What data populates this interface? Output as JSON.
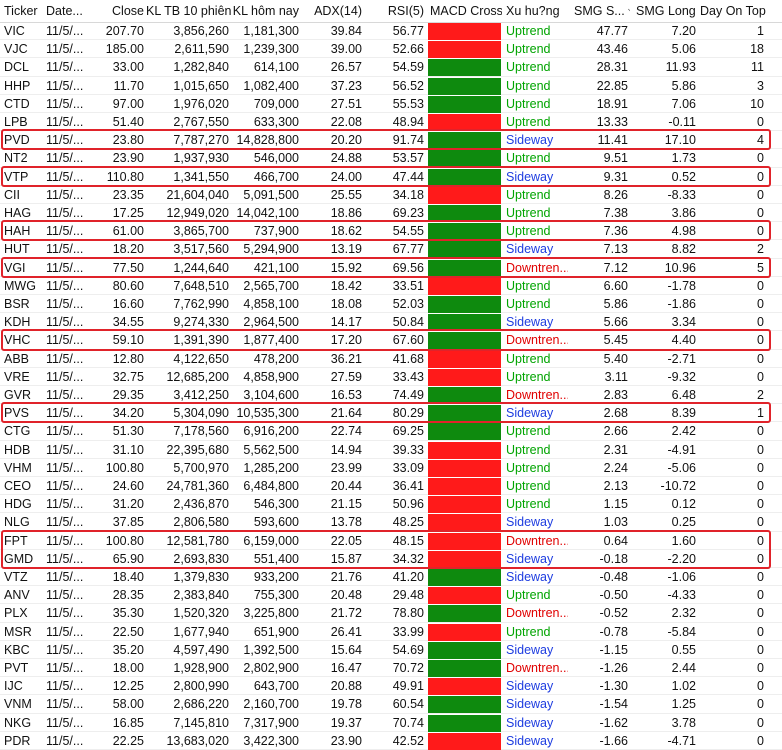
{
  "columns": {
    "ticker": "Ticker",
    "date": "Date...",
    "close": "Close",
    "kl10": "KL TB 10 phiên",
    "klday": "KL hôm nay",
    "adx": "ADX(14)",
    "rsi": "RSI(5)",
    "macd": "MACD Cross",
    "trend": "Xu hu?ng",
    "smg_short": "SMG S...",
    "smg_long": "SMG Long",
    "dayontop": "Day On Top"
  },
  "colors": {
    "macd_red": "#ff1a1a",
    "macd_green": "#0e8a0e",
    "uptrend": "#00a400",
    "sideway": "#1d3ce0",
    "downtrend": "#e00000",
    "highlight": "#e0232a"
  },
  "rows": [
    {
      "t": "VIC",
      "d": "11/5/...",
      "c": "207.70",
      "k10": "3,856,260",
      "kd": "1,181,300",
      "a": "39.84",
      "r": "56.77",
      "m": "red",
      "x": "Uptrend",
      "xt": "up",
      "s": "47.77",
      "l": "7.20",
      "o": "1"
    },
    {
      "t": "VJC",
      "d": "11/5/...",
      "c": "185.00",
      "k10": "2,611,590",
      "kd": "1,239,300",
      "a": "39.00",
      "r": "52.66",
      "m": "red",
      "x": "Uptrend",
      "xt": "up",
      "s": "43.46",
      "l": "5.06",
      "o": "18"
    },
    {
      "t": "DCL",
      "d": "11/5/...",
      "c": "33.00",
      "k10": "1,282,840",
      "kd": "614,100",
      "a": "26.57",
      "r": "54.59",
      "m": "green",
      "x": "Uptrend",
      "xt": "up",
      "s": "28.31",
      "l": "11.93",
      "o": "11"
    },
    {
      "t": "HHP",
      "d": "11/5/...",
      "c": "11.70",
      "k10": "1,015,650",
      "kd": "1,082,400",
      "a": "37.23",
      "r": "56.52",
      "m": "green",
      "x": "Uptrend",
      "xt": "up",
      "s": "22.85",
      "l": "5.86",
      "o": "3"
    },
    {
      "t": "CTD",
      "d": "11/5/...",
      "c": "97.00",
      "k10": "1,976,020",
      "kd": "709,000",
      "a": "27.51",
      "r": "55.53",
      "m": "green",
      "x": "Uptrend",
      "xt": "up",
      "s": "18.91",
      "l": "7.06",
      "o": "10"
    },
    {
      "t": "LPB",
      "d": "11/5/...",
      "c": "51.40",
      "k10": "2,767,550",
      "kd": "633,300",
      "a": "22.08",
      "r": "48.94",
      "m": "red",
      "x": "Uptrend",
      "xt": "up",
      "s": "13.33",
      "l": "-0.11",
      "o": "0"
    },
    {
      "t": "PVD",
      "d": "11/5/...",
      "c": "23.80",
      "k10": "7,787,270",
      "kd": "14,828,800",
      "a": "20.20",
      "r": "91.74",
      "m": "green",
      "x": "Sideway",
      "xt": "side",
      "s": "11.41",
      "l": "17.10",
      "o": "4"
    },
    {
      "t": "NT2",
      "d": "11/5/...",
      "c": "23.90",
      "k10": "1,937,930",
      "kd": "546,000",
      "a": "24.88",
      "r": "53.57",
      "m": "green",
      "x": "Uptrend",
      "xt": "up",
      "s": "9.51",
      "l": "1.73",
      "o": "0"
    },
    {
      "t": "VTP",
      "d": "11/5/...",
      "c": "110.80",
      "k10": "1,341,550",
      "kd": "466,700",
      "a": "24.00",
      "r": "47.44",
      "m": "green",
      "x": "Sideway",
      "xt": "side",
      "s": "9.31",
      "l": "0.52",
      "o": "0"
    },
    {
      "t": "CII",
      "d": "11/5/...",
      "c": "23.35",
      "k10": "21,604,040",
      "kd": "5,091,500",
      "a": "25.55",
      "r": "34.18",
      "m": "red",
      "x": "Uptrend",
      "xt": "up",
      "s": "8.26",
      "l": "-8.33",
      "o": "0"
    },
    {
      "t": "HAG",
      "d": "11/5/...",
      "c": "17.25",
      "k10": "12,949,020",
      "kd": "14,042,100",
      "a": "18.86",
      "r": "69.23",
      "m": "green",
      "x": "Uptrend",
      "xt": "up",
      "s": "7.38",
      "l": "3.86",
      "o": "0"
    },
    {
      "t": "HAH",
      "d": "11/5/...",
      "c": "61.00",
      "k10": "3,865,700",
      "kd": "737,900",
      "a": "18.62",
      "r": "54.55",
      "m": "green",
      "x": "Uptrend",
      "xt": "up",
      "s": "7.36",
      "l": "4.98",
      "o": "0"
    },
    {
      "t": "HUT",
      "d": "11/5/...",
      "c": "18.20",
      "k10": "3,517,560",
      "kd": "5,294,900",
      "a": "13.19",
      "r": "67.77",
      "m": "green",
      "x": "Sideway",
      "xt": "side",
      "s": "7.13",
      "l": "8.82",
      "o": "2"
    },
    {
      "t": "VGI",
      "d": "11/5/...",
      "c": "77.50",
      "k10": "1,244,640",
      "kd": "421,100",
      "a": "15.92",
      "r": "69.56",
      "m": "green",
      "x": "Downtren...",
      "xt": "down",
      "s": "7.12",
      "l": "10.96",
      "o": "5"
    },
    {
      "t": "MWG",
      "d": "11/5/...",
      "c": "80.60",
      "k10": "7,648,510",
      "kd": "2,565,700",
      "a": "18.42",
      "r": "33.51",
      "m": "red",
      "x": "Uptrend",
      "xt": "up",
      "s": "6.60",
      "l": "-1.78",
      "o": "0"
    },
    {
      "t": "BSR",
      "d": "11/5/...",
      "c": "16.60",
      "k10": "7,762,990",
      "kd": "4,858,100",
      "a": "18.08",
      "r": "52.03",
      "m": "green",
      "x": "Uptrend",
      "xt": "up",
      "s": "5.86",
      "l": "-1.86",
      "o": "0"
    },
    {
      "t": "KDH",
      "d": "11/5/...",
      "c": "34.55",
      "k10": "9,274,330",
      "kd": "2,964,500",
      "a": "14.17",
      "r": "50.84",
      "m": "green",
      "x": "Sideway",
      "xt": "side",
      "s": "5.66",
      "l": "3.34",
      "o": "0"
    },
    {
      "t": "VHC",
      "d": "11/5/...",
      "c": "59.10",
      "k10": "1,391,390",
      "kd": "1,877,400",
      "a": "17.20",
      "r": "67.60",
      "m": "green",
      "x": "Downtren...",
      "xt": "down",
      "s": "5.45",
      "l": "4.40",
      "o": "0"
    },
    {
      "t": "ABB",
      "d": "11/5/...",
      "c": "12.80",
      "k10": "4,122,650",
      "kd": "478,200",
      "a": "36.21",
      "r": "41.68",
      "m": "red",
      "x": "Uptrend",
      "xt": "up",
      "s": "5.40",
      "l": "-2.71",
      "o": "0"
    },
    {
      "t": "VRE",
      "d": "11/5/...",
      "c": "32.75",
      "k10": "12,685,200",
      "kd": "4,858,900",
      "a": "27.59",
      "r": "33.43",
      "m": "red",
      "x": "Uptrend",
      "xt": "up",
      "s": "3.11",
      "l": "-9.32",
      "o": "0"
    },
    {
      "t": "GVR",
      "d": "11/5/...",
      "c": "29.35",
      "k10": "3,412,250",
      "kd": "3,104,600",
      "a": "16.53",
      "r": "74.49",
      "m": "green",
      "x": "Downtren...",
      "xt": "down",
      "s": "2.83",
      "l": "6.48",
      "o": "2"
    },
    {
      "t": "PVS",
      "d": "11/5/...",
      "c": "34.20",
      "k10": "5,304,090",
      "kd": "10,535,300",
      "a": "21.64",
      "r": "80.29",
      "m": "green",
      "x": "Sideway",
      "xt": "side",
      "s": "2.68",
      "l": "8.39",
      "o": "1"
    },
    {
      "t": "CTG",
      "d": "11/5/...",
      "c": "51.30",
      "k10": "7,178,560",
      "kd": "6,916,200",
      "a": "22.74",
      "r": "69.25",
      "m": "green",
      "x": "Uptrend",
      "xt": "up",
      "s": "2.66",
      "l": "2.42",
      "o": "0"
    },
    {
      "t": "HDB",
      "d": "11/5/...",
      "c": "31.10",
      "k10": "22,395,680",
      "kd": "5,562,500",
      "a": "14.94",
      "r": "39.33",
      "m": "red",
      "x": "Uptrend",
      "xt": "up",
      "s": "2.31",
      "l": "-4.91",
      "o": "0"
    },
    {
      "t": "VHM",
      "d": "11/5/...",
      "c": "100.80",
      "k10": "5,700,970",
      "kd": "1,285,200",
      "a": "23.99",
      "r": "33.09",
      "m": "red",
      "x": "Uptrend",
      "xt": "up",
      "s": "2.24",
      "l": "-5.06",
      "o": "0"
    },
    {
      "t": "CEO",
      "d": "11/5/...",
      "c": "24.60",
      "k10": "24,781,360",
      "kd": "6,484,800",
      "a": "20.44",
      "r": "36.41",
      "m": "red",
      "x": "Uptrend",
      "xt": "up",
      "s": "2.13",
      "l": "-10.72",
      "o": "0"
    },
    {
      "t": "HDG",
      "d": "11/5/...",
      "c": "31.20",
      "k10": "2,436,870",
      "kd": "546,300",
      "a": "21.15",
      "r": "50.96",
      "m": "red",
      "x": "Uptrend",
      "xt": "up",
      "s": "1.15",
      "l": "0.12",
      "o": "0"
    },
    {
      "t": "NLG",
      "d": "11/5/...",
      "c": "37.85",
      "k10": "2,806,580",
      "kd": "593,600",
      "a": "13.78",
      "r": "48.25",
      "m": "red",
      "x": "Sideway",
      "xt": "side",
      "s": "1.03",
      "l": "0.25",
      "o": "0"
    },
    {
      "t": "FPT",
      "d": "11/5/...",
      "c": "100.80",
      "k10": "12,581,780",
      "kd": "6,159,000",
      "a": "22.05",
      "r": "48.15",
      "m": "red",
      "x": "Downtren...",
      "xt": "down",
      "s": "0.64",
      "l": "1.60",
      "o": "0"
    },
    {
      "t": "GMD",
      "d": "11/5/...",
      "c": "65.90",
      "k10": "2,693,830",
      "kd": "551,400",
      "a": "15.87",
      "r": "34.32",
      "m": "red",
      "x": "Sideway",
      "xt": "side",
      "s": "-0.18",
      "l": "-2.20",
      "o": "0"
    },
    {
      "t": "VTZ",
      "d": "11/5/...",
      "c": "18.40",
      "k10": "1,379,830",
      "kd": "933,200",
      "a": "21.76",
      "r": "41.20",
      "m": "green",
      "x": "Sideway",
      "xt": "side",
      "s": "-0.48",
      "l": "-1.06",
      "o": "0"
    },
    {
      "t": "ANV",
      "d": "11/5/...",
      "c": "28.35",
      "k10": "2,383,840",
      "kd": "755,300",
      "a": "20.48",
      "r": "29.48",
      "m": "red",
      "x": "Uptrend",
      "xt": "up",
      "s": "-0.50",
      "l": "-4.33",
      "o": "0"
    },
    {
      "t": "PLX",
      "d": "11/5/...",
      "c": "35.30",
      "k10": "1,520,320",
      "kd": "3,225,800",
      "a": "21.72",
      "r": "78.80",
      "m": "green",
      "x": "Downtren...",
      "xt": "down",
      "s": "-0.52",
      "l": "2.32",
      "o": "0"
    },
    {
      "t": "MSR",
      "d": "11/5/...",
      "c": "22.50",
      "k10": "1,677,940",
      "kd": "651,900",
      "a": "26.41",
      "r": "33.99",
      "m": "red",
      "x": "Uptrend",
      "xt": "up",
      "s": "-0.78",
      "l": "-5.84",
      "o": "0"
    },
    {
      "t": "KBC",
      "d": "11/5/...",
      "c": "35.20",
      "k10": "4,597,490",
      "kd": "1,392,500",
      "a": "15.64",
      "r": "54.69",
      "m": "green",
      "x": "Sideway",
      "xt": "side",
      "s": "-1.15",
      "l": "0.55",
      "o": "0"
    },
    {
      "t": "PVT",
      "d": "11/5/...",
      "c": "18.00",
      "k10": "1,928,900",
      "kd": "2,802,900",
      "a": "16.47",
      "r": "70.72",
      "m": "green",
      "x": "Downtren...",
      "xt": "down",
      "s": "-1.26",
      "l": "2.44",
      "o": "0"
    },
    {
      "t": "IJC",
      "d": "11/5/...",
      "c": "12.25",
      "k10": "2,800,990",
      "kd": "643,700",
      "a": "20.88",
      "r": "49.91",
      "m": "red",
      "x": "Sideway",
      "xt": "side",
      "s": "-1.30",
      "l": "1.02",
      "o": "0"
    },
    {
      "t": "VNM",
      "d": "11/5/...",
      "c": "58.00",
      "k10": "2,686,220",
      "kd": "2,160,700",
      "a": "19.78",
      "r": "60.54",
      "m": "green",
      "x": "Sideway",
      "xt": "side",
      "s": "-1.54",
      "l": "1.25",
      "o": "0"
    },
    {
      "t": "NKG",
      "d": "11/5/...",
      "c": "16.85",
      "k10": "7,145,810",
      "kd": "7,317,900",
      "a": "19.37",
      "r": "70.74",
      "m": "green",
      "x": "Sideway",
      "xt": "side",
      "s": "-1.62",
      "l": "3.78",
      "o": "0"
    },
    {
      "t": "PDR",
      "d": "11/5/...",
      "c": "22.25",
      "k10": "13,683,020",
      "kd": "3,422,300",
      "a": "23.90",
      "r": "42.52",
      "m": "red",
      "x": "Sideway",
      "xt": "side",
      "s": "-1.66",
      "l": "-4.71",
      "o": "0"
    }
  ],
  "highlight_groups": [
    [
      "PVD"
    ],
    [
      "VTP"
    ],
    [
      "HAH"
    ],
    [
      "VGI"
    ],
    [
      "VHC"
    ],
    [
      "PVS"
    ],
    [
      "FPT",
      "GMD"
    ]
  ]
}
